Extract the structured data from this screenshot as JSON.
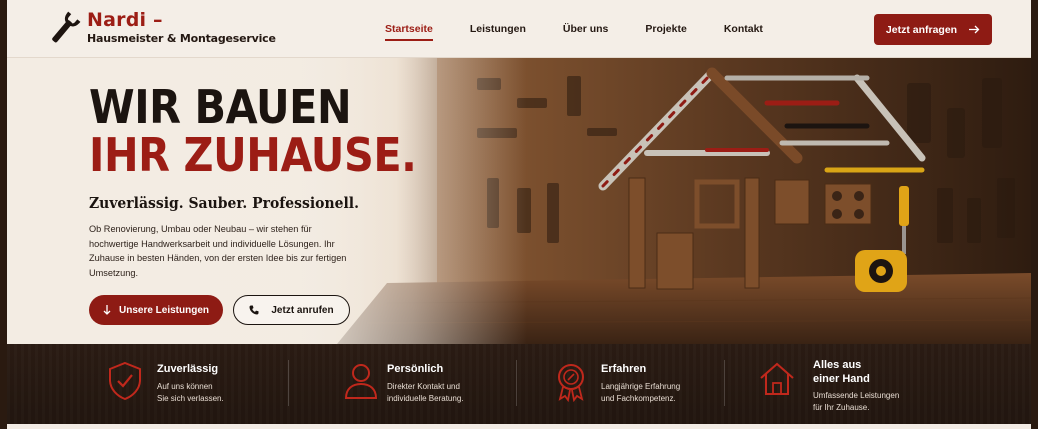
{
  "brand": {
    "name": "Nardi –",
    "subtitle": "Hausmeister & Montageservice"
  },
  "nav": {
    "items": [
      {
        "label": "Startseite",
        "active": true
      },
      {
        "label": "Leistungen",
        "active": false
      },
      {
        "label": "Über uns",
        "active": false
      },
      {
        "label": "Projekte",
        "active": false
      },
      {
        "label": "Kontakt",
        "active": false
      }
    ],
    "cta_label": "Jetzt anfragen"
  },
  "hero": {
    "title_line1": "WIR BAUEN",
    "title_line2": "IHR ZUHAUSE.",
    "tagline": "Zuverlässig. Sauber. Professionell.",
    "description": "Ob Renovierung, Umbau oder Neubau – wir stehen für hochwertige Handwerksarbeit und individuelle Lösungen. Ihr Zuhause in besten Händen, von der ersten Idee bis zur fertigen Umsetzung.",
    "primary_button": "Unsere Leistungen",
    "secondary_button": "Jetzt anrufen"
  },
  "features": [
    {
      "icon": "shield-check-icon",
      "title": "Zuverlässig",
      "text_line1": "Auf uns können",
      "text_line2": "Sie sich verlassen."
    },
    {
      "icon": "person-icon",
      "title": "Persönlich",
      "text_line1": "Direkter Kontakt und",
      "text_line2": "individuelle Beratung."
    },
    {
      "icon": "award-badge-icon",
      "title": "Erfahren",
      "text_line1": "Langjährige Erfahrung",
      "text_line2": "und Fachkompetenz."
    },
    {
      "icon": "house-icon",
      "title_line1": "Alles aus",
      "title_line2": "einer Hand",
      "text_line1": "Umfassende Leistungen",
      "text_line2": "für Ihr Zuhause."
    }
  ],
  "colors": {
    "accent": "#9c1d15",
    "button": "#8e1b14",
    "dark": "#1b1410",
    "header_bg": "#f4eee7",
    "features_bg": "#2b1c14"
  }
}
